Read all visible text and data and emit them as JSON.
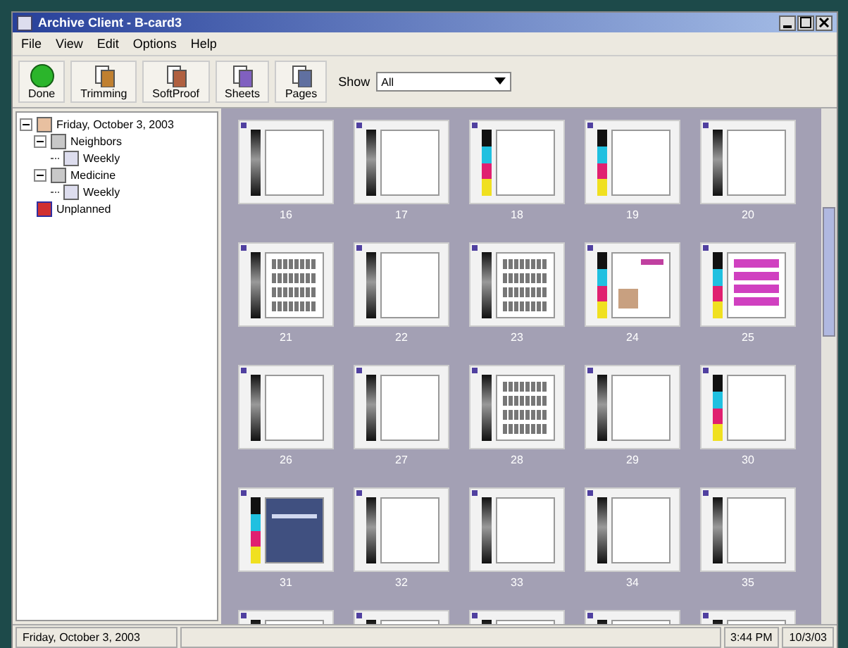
{
  "window": {
    "title": "Archive Client - B-card3"
  },
  "menu": [
    "File",
    "View",
    "Edit",
    "Options",
    "Help"
  ],
  "toolbar": [
    {
      "label": "Done",
      "kind": "status"
    },
    {
      "label": "Trimming",
      "kind": "trim"
    },
    {
      "label": "SoftProof",
      "kind": "proof"
    },
    {
      "label": "Sheets",
      "kind": "sheets"
    },
    {
      "label": "Pages",
      "kind": "pages"
    }
  ],
  "show": {
    "label": "Show",
    "value": "All"
  },
  "tree": [
    {
      "label": "Friday, October 3, 2003",
      "kind": "day",
      "expanded": true,
      "children": [
        {
          "label": "Neighbors",
          "kind": "section",
          "expanded": true,
          "children": [
            {
              "label": "Weekly",
              "kind": "edition"
            }
          ]
        },
        {
          "label": "Medicine",
          "kind": "section",
          "expanded": true,
          "children": [
            {
              "label": "Weekly",
              "kind": "edition"
            }
          ]
        }
      ]
    },
    {
      "label": "Unplanned",
      "kind": "unplanned"
    }
  ],
  "pages": [
    {
      "label": "16",
      "kind": "blank"
    },
    {
      "label": "17",
      "kind": "blank"
    },
    {
      "label": "18",
      "kind": "cmyk"
    },
    {
      "label": "19",
      "kind": "cmyk"
    },
    {
      "label": "20",
      "kind": "blank"
    },
    {
      "label": "21",
      "kind": "text"
    },
    {
      "label": "22",
      "kind": "blank"
    },
    {
      "label": "23",
      "kind": "text"
    },
    {
      "label": "24",
      "kind": "cmyk-pink"
    },
    {
      "label": "25",
      "kind": "cmyk-magenta"
    },
    {
      "label": "26",
      "kind": "blank"
    },
    {
      "label": "27",
      "kind": "blank"
    },
    {
      "label": "28",
      "kind": "text"
    },
    {
      "label": "29",
      "kind": "blank"
    },
    {
      "label": "30",
      "kind": "cmyk"
    },
    {
      "label": "31",
      "kind": "cmyk-photo"
    },
    {
      "label": "32",
      "kind": "blank"
    },
    {
      "label": "33",
      "kind": "blank"
    },
    {
      "label": "34",
      "kind": "blank"
    },
    {
      "label": "35",
      "kind": "blank"
    },
    {
      "kind": "blank"
    },
    {
      "kind": "blank"
    },
    {
      "kind": "blank"
    },
    {
      "kind": "blank"
    },
    {
      "kind": "blank"
    }
  ],
  "status_bar": {
    "date": "Friday, October 3, 2003",
    "time": "3:44 PM",
    "short_date": "10/3/03"
  }
}
